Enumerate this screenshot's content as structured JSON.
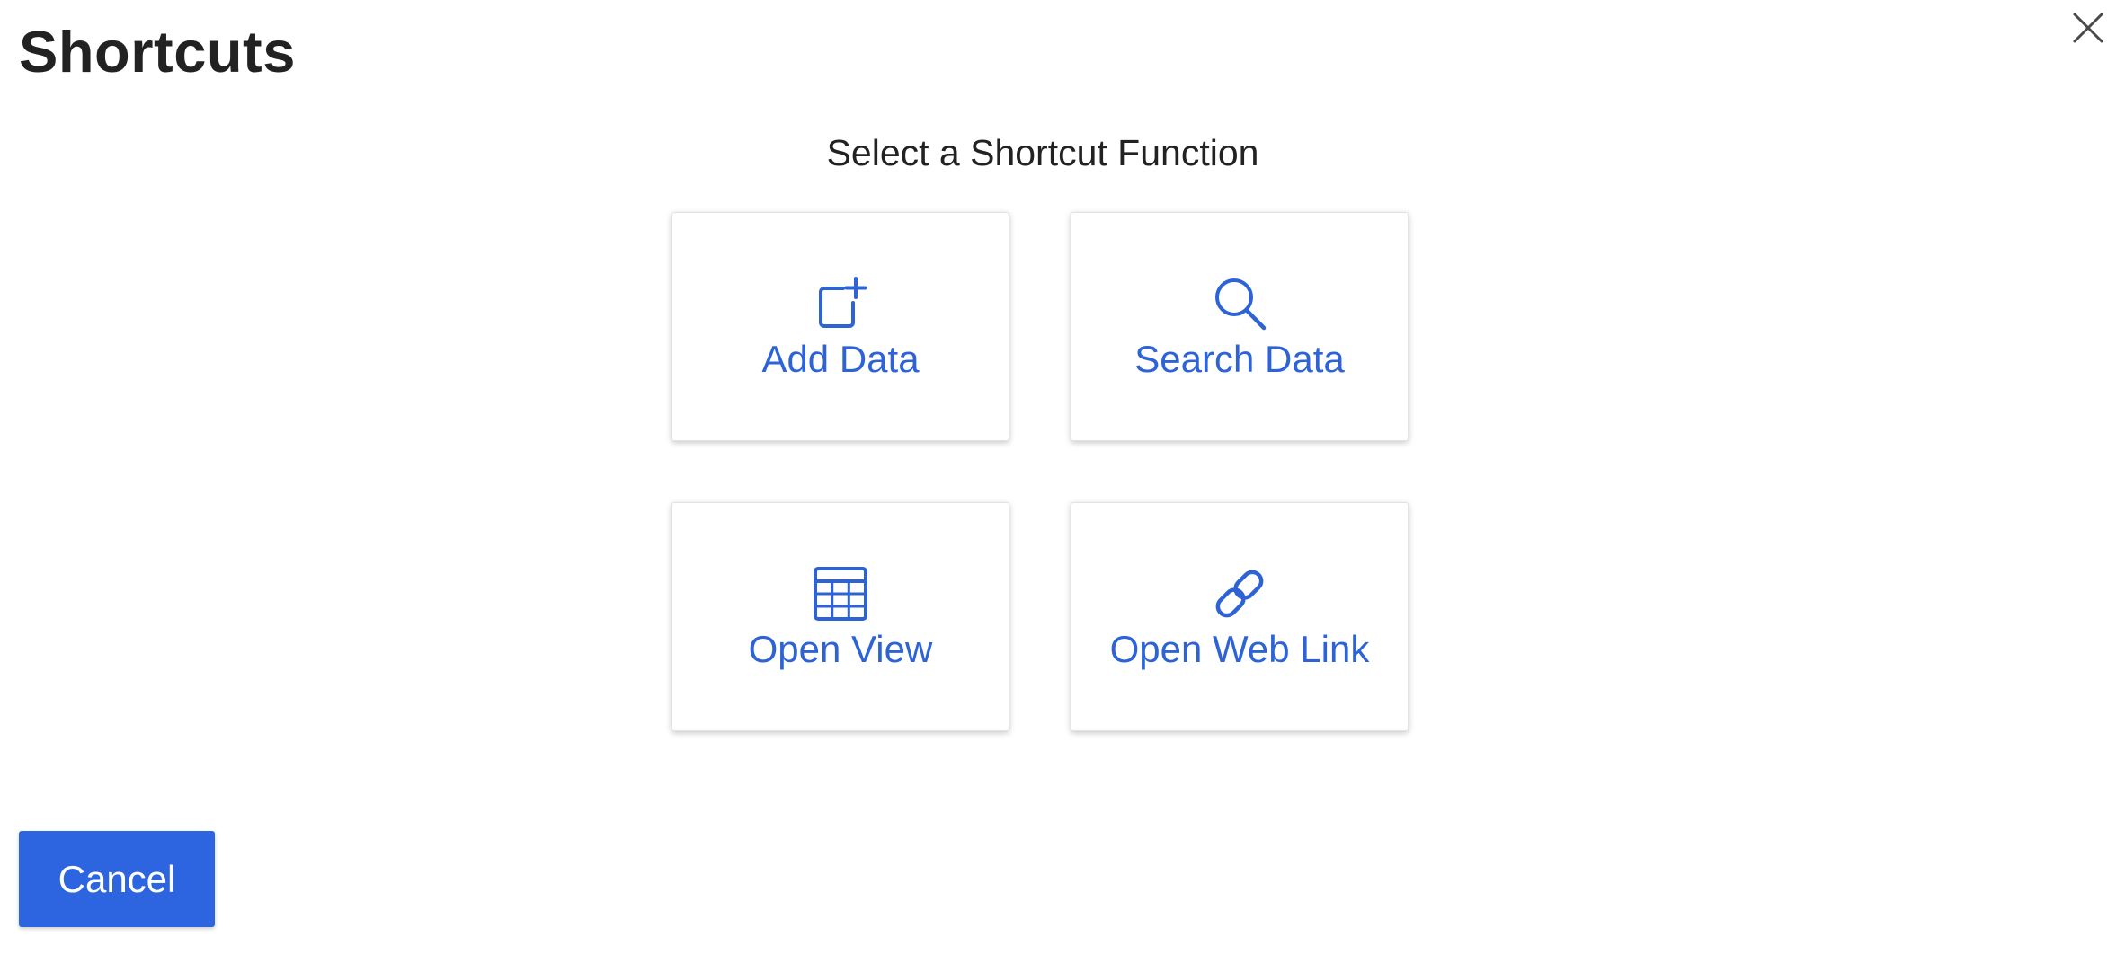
{
  "dialog": {
    "title": "Shortcuts",
    "subtitle": "Select a Shortcut Function",
    "close_icon": "close-icon"
  },
  "shortcuts": [
    {
      "label": "Add Data",
      "icon": "add-square-icon"
    },
    {
      "label": "Search Data",
      "icon": "search-icon"
    },
    {
      "label": "Open View",
      "icon": "table-grid-icon"
    },
    {
      "label": "Open Web Link",
      "icon": "link-icon"
    }
  ],
  "footer": {
    "cancel_label": "Cancel"
  },
  "colors": {
    "accent": "#2d63d6",
    "button_bg": "#2d65e0",
    "title_text": "#222222"
  }
}
